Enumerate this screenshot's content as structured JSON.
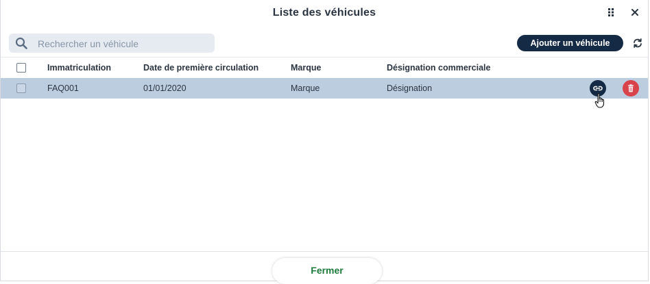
{
  "dialog": {
    "title": "Liste des véhicules"
  },
  "toolbar": {
    "search_placeholder": "Rechercher un véhicule",
    "search_value": "",
    "add_label": "Ajouter un véhicule"
  },
  "table": {
    "columns": [
      "Immatriculation",
      "Date de première circulation",
      "Marque",
      "Désignation commerciale"
    ],
    "rows": [
      {
        "immatriculation": "FAQ001",
        "date": "01/01/2020",
        "marque": "Marque",
        "designation": "Désignation",
        "selected": false,
        "highlighted": true
      }
    ]
  },
  "footer": {
    "close_label": "Fermer"
  },
  "colors": {
    "primary": "#152a45",
    "danger": "#d9434a",
    "row_highlight": "#bccde0",
    "close_text": "#1e7a3a"
  },
  "icons": [
    "drag-grip-icon",
    "close-icon",
    "search-icon",
    "refresh-icon",
    "link-icon",
    "trash-icon",
    "hand-cursor-icon"
  ]
}
